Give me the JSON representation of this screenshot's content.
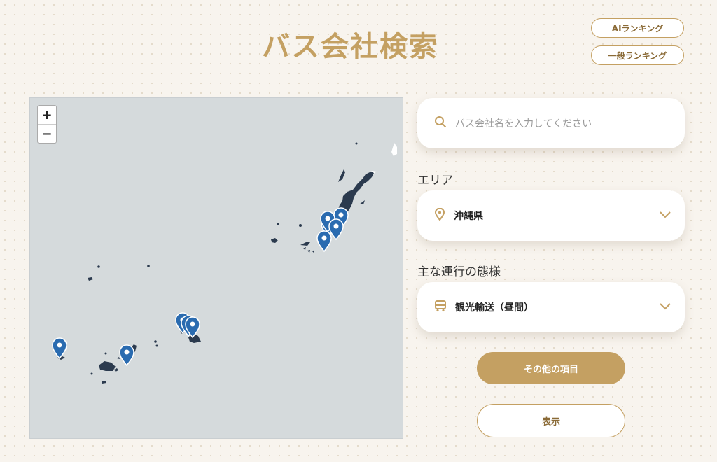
{
  "page": {
    "title": "バス会社検索"
  },
  "ranking": {
    "ai_label": "AIランキング",
    "general_label": "一般ランキング"
  },
  "map": {
    "zoom_in": "+",
    "zoom_out": "−",
    "marker_icon": "map-pin-icon",
    "marker_color": "#2a6bb0"
  },
  "search": {
    "placeholder": "バス会社名を入力してください",
    "icon": "search-icon"
  },
  "area": {
    "label": "エリア",
    "value": "沖縄県",
    "icon": "location-pin-icon"
  },
  "operation": {
    "label": "主な運行の態様",
    "value": "観光輸送（昼間）",
    "icon": "bus-icon"
  },
  "buttons": {
    "more": "その他の項目",
    "show": "表示"
  },
  "colors": {
    "accent": "#c4a062",
    "map_bg": "#d5dadc",
    "island": "#2b3a4e"
  }
}
